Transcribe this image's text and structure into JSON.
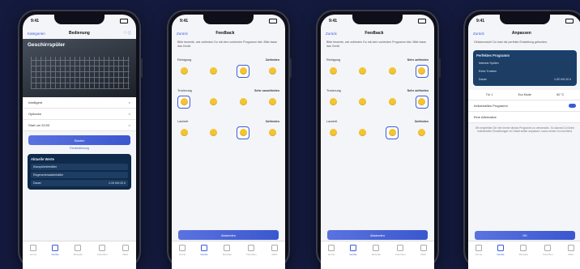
{
  "status": {
    "time": "9:41"
  },
  "tabs": [
    "Home",
    "Geräte",
    "Rezepte",
    "Favoriten",
    "Mehr"
  ],
  "phone1": {
    "nav": {
      "back": "Kategorien",
      "title": "Bedienung"
    },
    "hero_title": "Geschirrspüler",
    "rows": [
      {
        "label": "Intelligent",
        "value": ">"
      },
      {
        "label": "Optionen",
        "value": ">"
      },
      {
        "label": "Start um 20:00",
        "value": ">"
      }
    ],
    "start_label": "Starten",
    "link_label": "Fernbedienung",
    "card": {
      "title": "Aktuelle Werte",
      "rows": [
        {
          "label": "Klarspülerbehälter",
          "value": ""
        },
        {
          "label": "Regeneriersalzbehälter",
          "value": ""
        },
        {
          "label": "Dauer",
          "value": "1:19 h/0:10 h"
        }
      ]
    }
  },
  "feedback": {
    "nav": {
      "back": "Zurück",
      "title": "Feedback"
    },
    "intro": "Bitte bewerte, wie zufrieden Du mit dem vorletzten Programm bist. Bitte lasse das Gerät."
  },
  "phone2": {
    "questions": [
      {
        "label": "Reinigung",
        "answer": "Zufrieden",
        "selected": 3
      },
      {
        "label": "Trocknung",
        "answer": "Sehr unzufrieden",
        "selected": 1
      },
      {
        "label": "Laufzeit",
        "answer": "Zufrieden",
        "selected": 3
      }
    ],
    "submit": "Absenden"
  },
  "phone3": {
    "questions": [
      {
        "label": "Reinigung",
        "answer": "Sehr zufrieden",
        "selected": 4
      },
      {
        "label": "Trocknung",
        "answer": "Sehr zufrieden",
        "selected": 4
      },
      {
        "label": "Laufzeit",
        "answer": "Zufrieden",
        "selected": 3
      }
    ],
    "submit": "Absenden"
  },
  "phone4": {
    "nav": {
      "back": "Zurück",
      "title": "Anpassen"
    },
    "intro": "Glückwunsch! Du hast die perfekte Einstellung gefunden.",
    "card": {
      "title": "Perfektes Programm",
      "rows": [
        {
          "label": "Intensiv Spülen",
          "value": ""
        },
        {
          "label": "Extra Trocken",
          "value": ""
        },
        {
          "label": "Dauer",
          "value": "1:32 h/0:10 h"
        }
      ]
    },
    "options": [
      "Tür 1",
      "Eco Mode",
      "60 °C"
    ],
    "toggle_label": "Individuelles Programm",
    "name_label": "Eine Alternative",
    "note": "Wir empfehlen Dir hier immer dieses Programm zu verwenden. So kannst Du Deine individuellen Einstellungen im Detail weiter anpassen, wann immer Du möchtest.",
    "ok": "OK"
  }
}
